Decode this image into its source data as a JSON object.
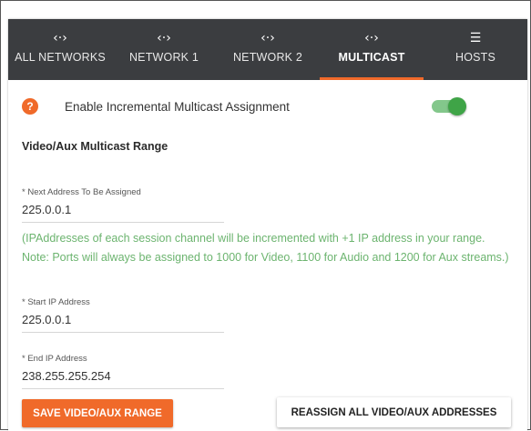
{
  "tabs": [
    {
      "label": "ALL NETWORKS",
      "icon": "code-brackets-icon",
      "glyph": "‹·›"
    },
    {
      "label": "NETWORK 1",
      "icon": "code-brackets-icon",
      "glyph": "‹·›"
    },
    {
      "label": "NETWORK 2",
      "icon": "code-brackets-icon",
      "glyph": "‹·›"
    },
    {
      "label": "MULTICAST",
      "icon": "code-brackets-icon",
      "glyph": "‹·›",
      "active": true
    },
    {
      "label": "HOSTS",
      "icon": "list-icon",
      "glyph": "☰"
    }
  ],
  "toggle": {
    "help_glyph": "?",
    "label": "Enable Incremental Multicast Assignment",
    "on": true
  },
  "section": {
    "title": "Video/Aux Multicast Range"
  },
  "fields": {
    "next_address": {
      "label": "* Next Address To Be Assigned",
      "value": "225.0.0.1"
    },
    "start_ip": {
      "label": "* Start IP Address",
      "value": "225.0.0.1"
    },
    "end_ip": {
      "label": "* End IP Address",
      "value": "238.255.255.254"
    }
  },
  "note": "(IPAddresses of each session channel will be incremented with +1 IP address in your range. Note: Ports will always be assigned to 1000 for Video, 1100 for Audio and 1200 for Aux streams.)",
  "buttons": {
    "save": "SAVE VIDEO/AUX RANGE",
    "reassign": "REASSIGN ALL VIDEO/AUX ADDRESSES"
  },
  "colors": {
    "accent": "#f06a2a",
    "tabbar": "#3b3d40",
    "note_green": "#6cb46f",
    "toggle_on": "#3fa447"
  }
}
